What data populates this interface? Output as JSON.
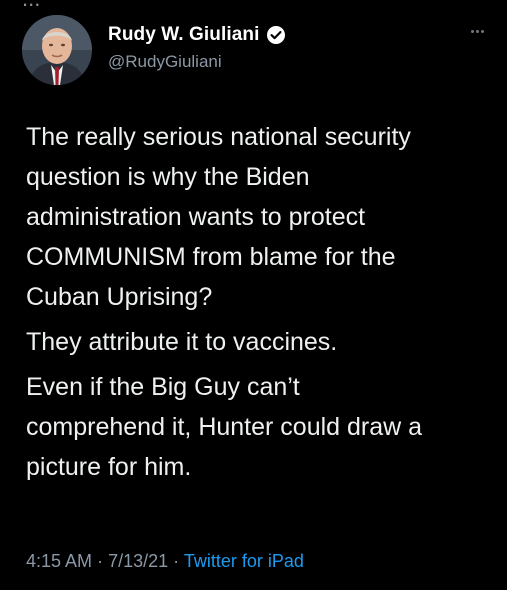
{
  "top_partial_text": "...",
  "tweet": {
    "author": {
      "display_name": "Rudy W. Giuliani",
      "handle": "@RudyGiuliani",
      "verified": true
    },
    "paragraphs": [
      "The really serious national security\nquestion is why the Biden\nadministration wants  to protect\nCOMMUNISM from blame for the\nCuban Uprising?",
      "They attribute it to vaccines.",
      "Even if the Big Guy can’t\ncomprehend it, Hunter could draw a\npicture for him."
    ],
    "time": "4:15 AM",
    "separator": "·",
    "date": "7/13/21",
    "source": "Twitter for iPad"
  },
  "icons": {
    "verified": "verified-badge-icon",
    "more": "more-options-icon"
  },
  "colors": {
    "background": "#000000",
    "text": "#eef0f1",
    "secondary": "#8b98a5",
    "link": "#1d9bf0"
  }
}
